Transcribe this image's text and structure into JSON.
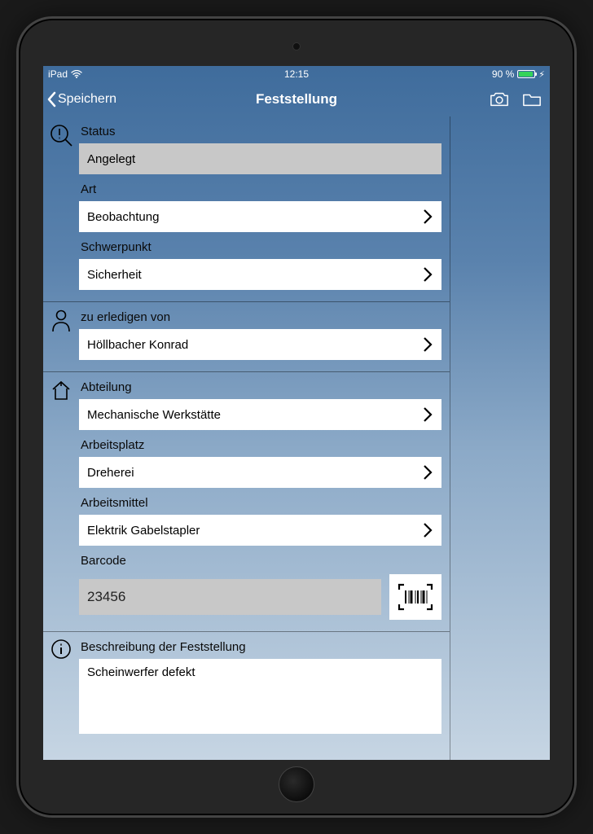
{
  "status_bar": {
    "device": "iPad",
    "time": "12:15",
    "battery": "90 %"
  },
  "nav": {
    "back": "Speichern",
    "title": "Feststellung"
  },
  "identity": {
    "status_label": "Status",
    "status_value": "Angelegt",
    "art_label": "Art",
    "art_value": "Beobachtung",
    "schwerpunkt_label": "Schwerpunkt",
    "schwerpunkt_value": "Sicherheit"
  },
  "responsible": {
    "label": "zu erledigen von",
    "value": "Höllbacher Konrad"
  },
  "location": {
    "abteilung_label": "Abteilung",
    "abteilung_value": "Mechanische Werkstätte",
    "arbeitsplatz_label": "Arbeitsplatz",
    "arbeitsplatz_value": "Dreherei",
    "arbeitsmittel_label": "Arbeitsmittel",
    "arbeitsmittel_value": "Elektrik Gabelstapler",
    "barcode_label": "Barcode",
    "barcode_value": "23456"
  },
  "description": {
    "label": "Beschreibung der Feststellung",
    "value": "Scheinwerfer defekt"
  }
}
